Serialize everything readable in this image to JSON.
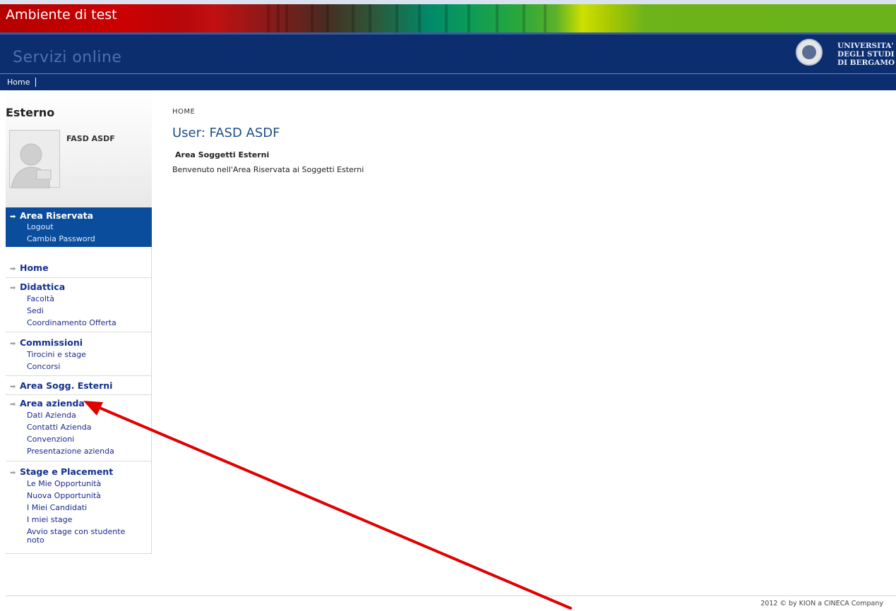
{
  "environment": {
    "title": "Ambiente di test"
  },
  "header": {
    "title": "Servizi online",
    "university": [
      "UNIVERSITA'",
      "DEGLI STUDI",
      "DI BERGAMO"
    ]
  },
  "topnav": {
    "home": "Home"
  },
  "sidebar": {
    "role": "Esterno",
    "username": "FASD ASDF",
    "area_riservata": {
      "title": "Area Riservata",
      "links": [
        "Logout",
        "Cambia Password"
      ]
    },
    "sections": [
      {
        "title": "Home",
        "links": []
      },
      {
        "title": "Didattica",
        "links": [
          "Facoltà",
          "Sedi",
          "Coordinamento Offerta"
        ]
      },
      {
        "title": "Commissioni",
        "links": [
          "Tirocini e stage",
          "Concorsi"
        ]
      },
      {
        "title": "Area Sogg. Esterni",
        "links": []
      },
      {
        "title": "Area azienda",
        "links": [
          "Dati Azienda",
          "Contatti Azienda",
          "Convenzioni",
          "Presentazione azienda"
        ]
      },
      {
        "title": "Stage e Placement",
        "links": [
          "Le Mie Opportunità",
          "Nuova Opportunità",
          "I Miei Candidati",
          "I miei stage",
          "Avvio stage con studente noto"
        ]
      }
    ]
  },
  "main": {
    "breadcrumb": "HOME",
    "user_title": "User: FASD ASDF",
    "area_heading": "Area Soggetti Esterni",
    "welcome": "Benvenuto nell'Area Riservata ai Soggetti Esterni"
  },
  "footer": {
    "text": "2012 © by KION a CINECA Company"
  },
  "colors": {
    "header": "#0c2d6e",
    "area_riservata": "#0a4d9c",
    "link": "#13318c",
    "annotation_arrow": "#e00000"
  }
}
